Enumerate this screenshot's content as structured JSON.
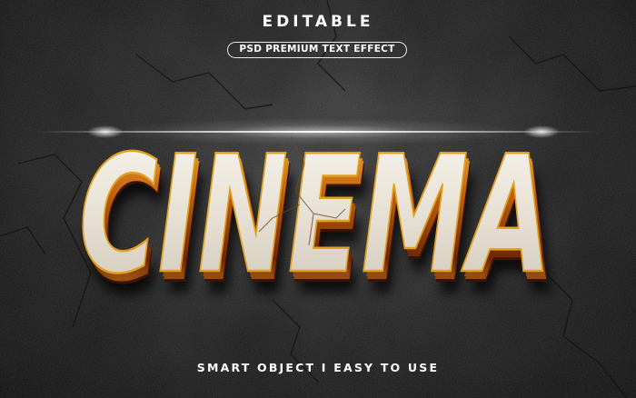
{
  "header": {
    "title": "EDITABLE",
    "badge": "PSD PREMIUM TEXT EFFECT"
  },
  "hero": {
    "text": "CINEMA",
    "face_color": "#ece6dc",
    "edge_color": "#e0a020",
    "extrusion_color": "#8a3a06"
  },
  "footer": {
    "caption": "SMART OBJECT I EASY TO USE"
  },
  "theme": {
    "background": "#2a2a2a",
    "text_color": "#ffffff"
  }
}
